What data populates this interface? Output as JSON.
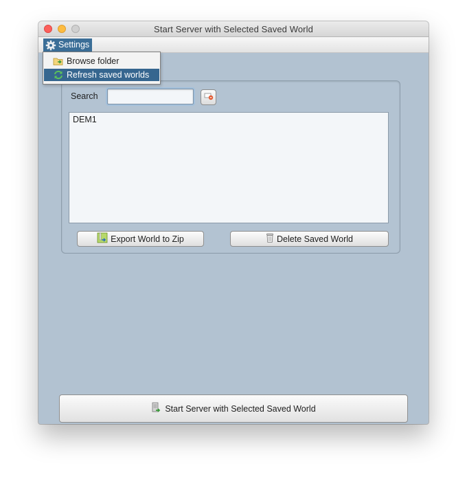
{
  "window": {
    "title": "Start Server with Selected Saved World",
    "controls": [
      "close",
      "minimize",
      "zoom"
    ]
  },
  "menubar": {
    "settings_label": "Settings",
    "settings_icon": "gear-icon"
  },
  "settings_menu": {
    "items": [
      {
        "label": "Browse folder",
        "icon": "folder-icon",
        "selected": false
      },
      {
        "label": "Refresh saved worlds",
        "icon": "refresh-icon",
        "selected": true
      }
    ]
  },
  "search": {
    "label": "Search",
    "value": "",
    "clear_icon": "clear-search-icon"
  },
  "worlds_list": {
    "items": [
      "DEM1"
    ]
  },
  "actions": {
    "export_label": "Export World to Zip",
    "delete_label": "Delete Saved World",
    "start_label": "Start Server with Selected Saved World"
  },
  "colors": {
    "window_background": "#b2c2d1",
    "selection": "#36668f",
    "menu_highlight": "#3b6e97"
  }
}
